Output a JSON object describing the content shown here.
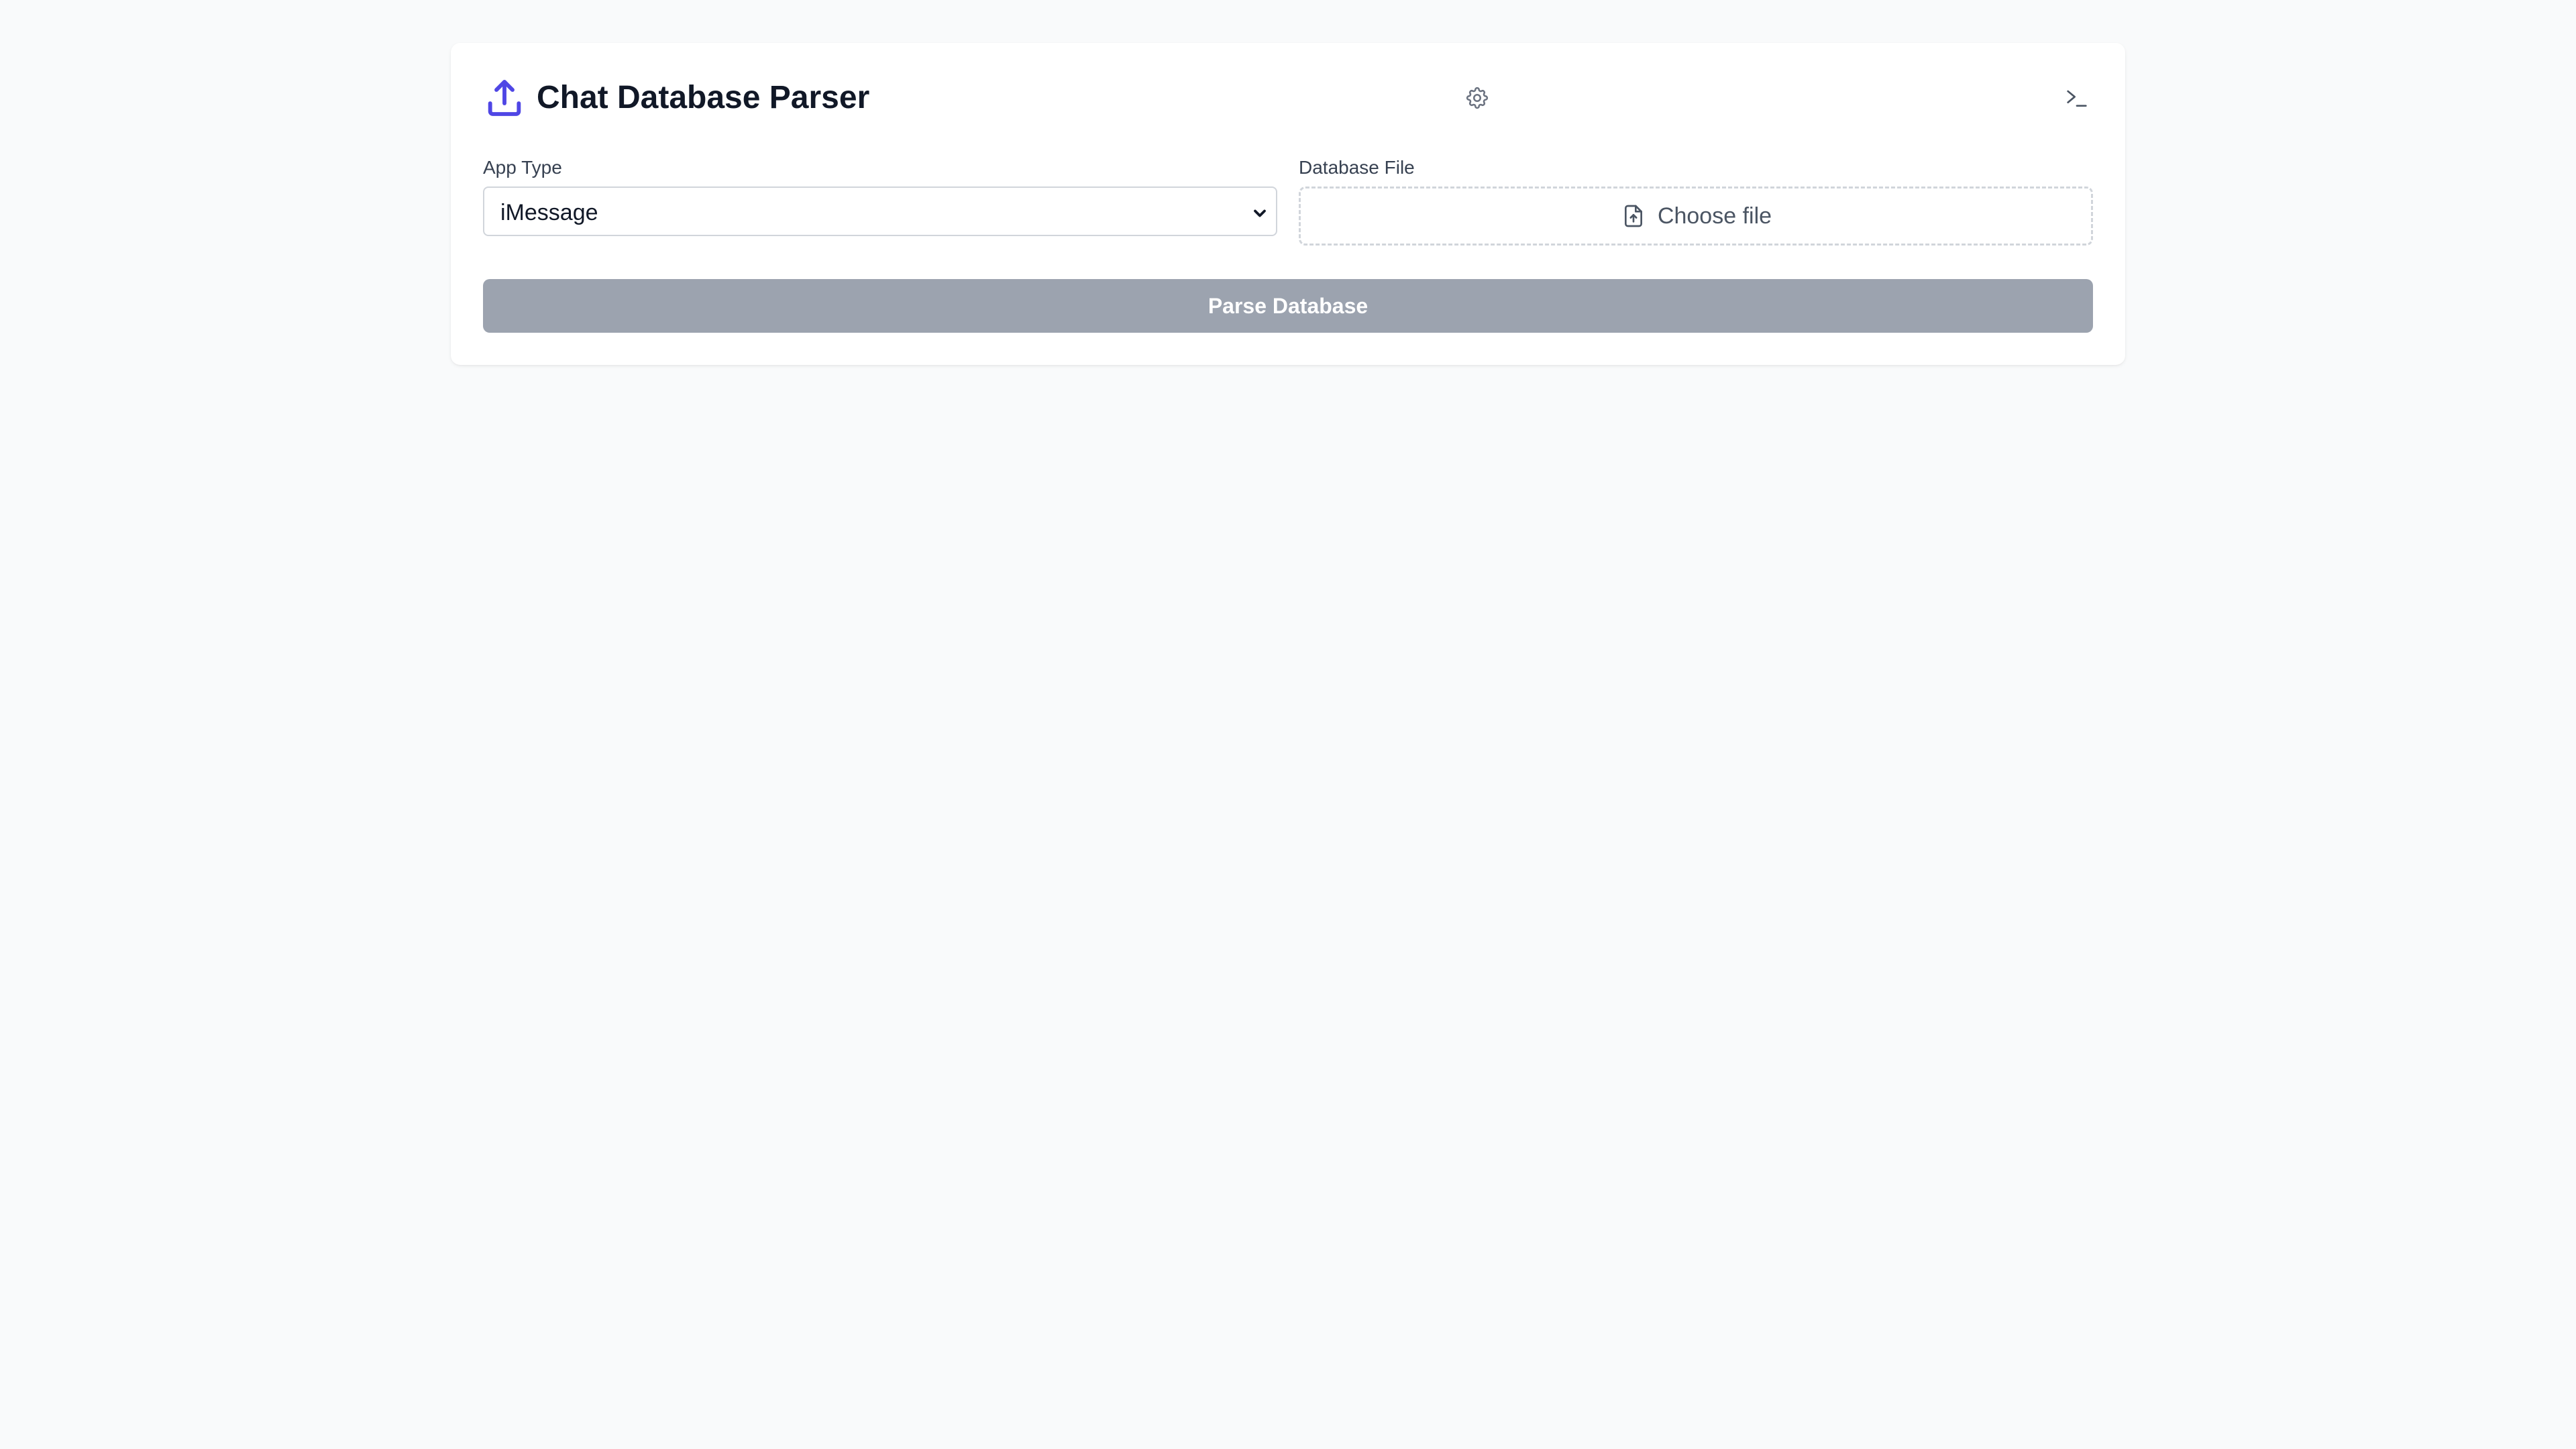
{
  "header": {
    "title": "Chat Database Parser",
    "logo_icon": "upload-tray-icon",
    "settings_icon": "gear-icon",
    "terminal_icon": "terminal-icon"
  },
  "form": {
    "app_type": {
      "label": "App Type",
      "selected": "iMessage"
    },
    "database_file": {
      "label": "Database File",
      "button_label": "Choose file",
      "icon": "file-upload-icon"
    }
  },
  "actions": {
    "parse_label": "Parse Database"
  },
  "colors": {
    "accent": "#4f46e5",
    "button_disabled": "#9ca3af",
    "title_text": "#111827",
    "background": "#f9fafb"
  }
}
